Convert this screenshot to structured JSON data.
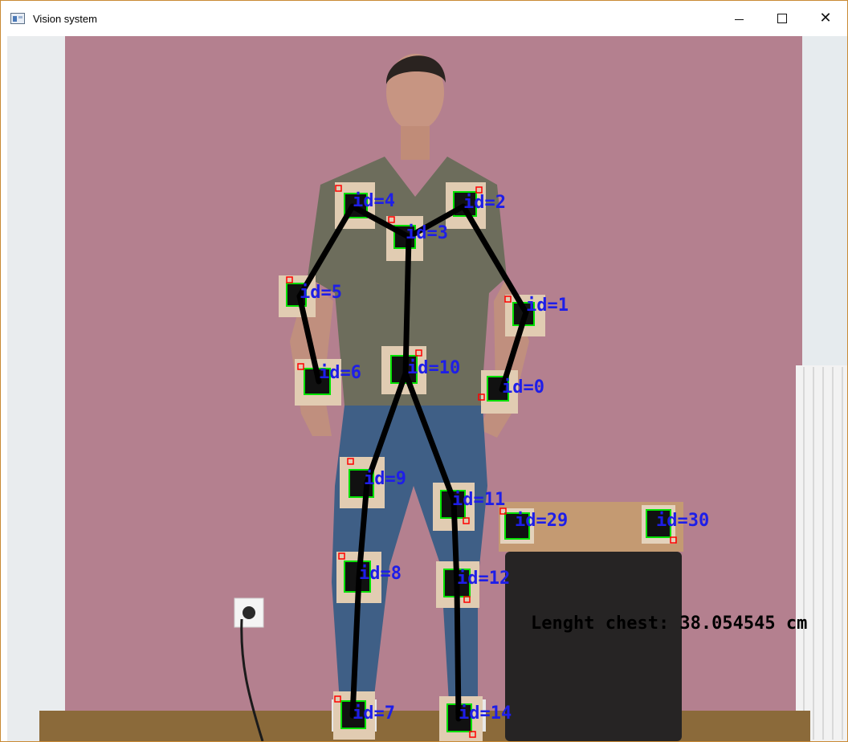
{
  "window": {
    "title": "Vision system",
    "icon": "app-window-icon",
    "controls": {
      "minimize": "minimize-icon",
      "maximize": "maximize-icon",
      "close": "close-icon"
    }
  },
  "overlay": {
    "measurement": "Lenght chest: 38.054545 cm"
  },
  "markers": [
    {
      "key": "m4",
      "label": "id=4"
    },
    {
      "key": "m2",
      "label": "id=2"
    },
    {
      "key": "m3",
      "label": "id=3"
    },
    {
      "key": "m5",
      "label": "id=5"
    },
    {
      "key": "m1",
      "label": "id=1"
    },
    {
      "key": "m6",
      "label": "id=6"
    },
    {
      "key": "m10",
      "label": "id=10"
    },
    {
      "key": "m0",
      "label": "id=0"
    },
    {
      "key": "m9",
      "label": "id=9"
    },
    {
      "key": "m11",
      "label": "id=11"
    },
    {
      "key": "m29",
      "label": "id=29"
    },
    {
      "key": "m30",
      "label": "id=30"
    },
    {
      "key": "m8",
      "label": "id=8"
    },
    {
      "key": "m12",
      "label": "id=12"
    },
    {
      "key": "m7",
      "label": "id=7"
    },
    {
      "key": "m14",
      "label": "id=14"
    }
  ],
  "colors": {
    "label": "#1e1ee8",
    "skeleton": "#000000",
    "marker_border": "#00e000",
    "marker_corner": "#ff0000",
    "wall": "#b07f8f"
  }
}
